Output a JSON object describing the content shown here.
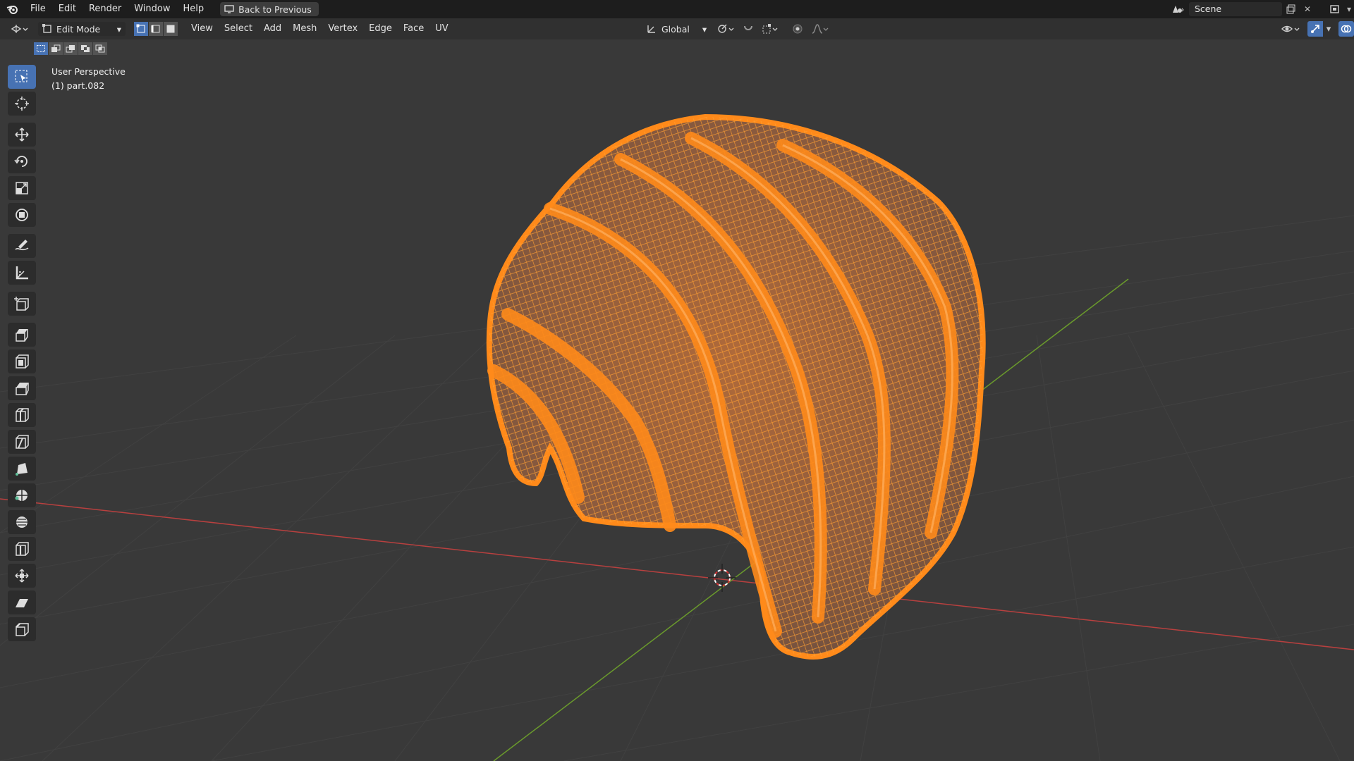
{
  "menubar": {
    "items": [
      "File",
      "Edit",
      "Render",
      "Window",
      "Help"
    ],
    "back_button": "Back to Previous",
    "scene_name": "Scene"
  },
  "header": {
    "mode": "Edit Mode",
    "menus": [
      "View",
      "Select",
      "Add",
      "Mesh",
      "Vertex",
      "Edge",
      "Face",
      "UV"
    ],
    "orientation": "Global",
    "select_modes": [
      "vertex-select",
      "edge-select",
      "face-select"
    ],
    "active_select_mode": "vertex-select"
  },
  "viewport": {
    "view_name": "User Perspective",
    "object_name": "(1) part.082"
  },
  "toolbar": {
    "tools": [
      "select-box",
      "cursor",
      "move",
      "rotate",
      "scale",
      "transform",
      "annotate",
      "measure",
      "add-cube",
      "extrude-region",
      "inset-faces",
      "bevel",
      "loop-cut",
      "knife",
      "poly-build",
      "spin",
      "smooth",
      "edge-slide",
      "shrink-fatten",
      "shear",
      "rip-region"
    ],
    "active_tool": "select-box"
  },
  "colors": {
    "accent": "#4772b3",
    "mesh": "#ff8a1a",
    "x_axis": "#b8403f",
    "y_axis": "#6a9a2c",
    "background": "#393939"
  }
}
